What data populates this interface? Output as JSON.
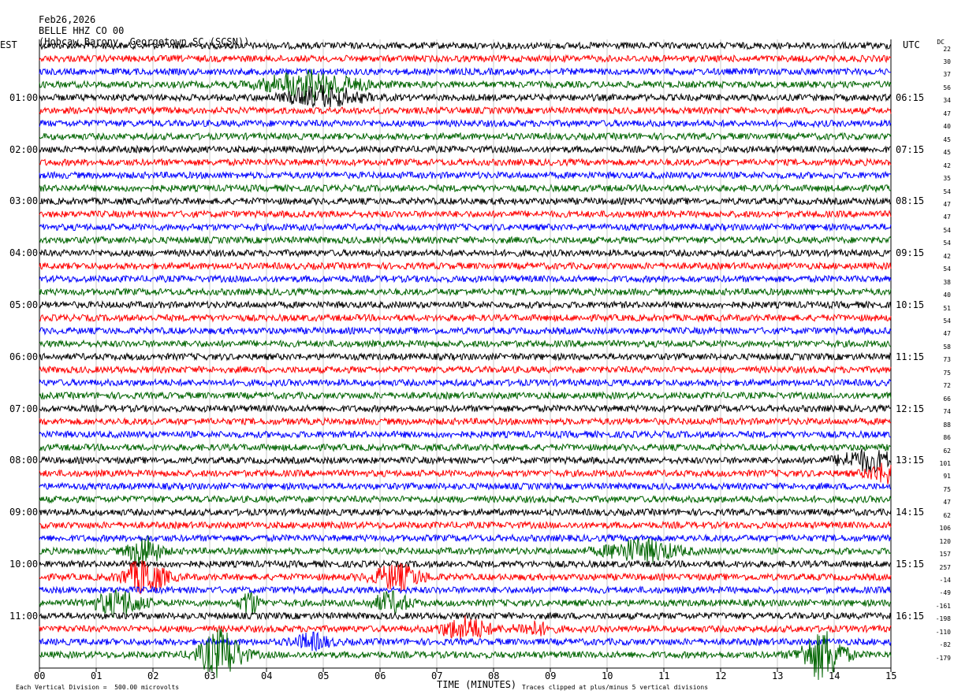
{
  "header": {
    "date": "Feb26,2026",
    "station": "BELLE HHZ CO 00",
    "location": "(Hobcaw Barony, Georgetown SC (SCSN))"
  },
  "left_axis_title": "EST",
  "right_axis_title": "UTC",
  "dc_label": "DC",
  "footer": {
    "scale": "Each Vertical Division =  500.00 microvolts",
    "xlabel": "TIME (MINUTES)",
    "clip_note": "Traces clipped at plus/minus 5 vertical divisions"
  },
  "colors": {
    "trace_cycle": [
      "#000000",
      "#ff0000",
      "#0000ff",
      "#006400"
    ],
    "grid": "#c8c8c8"
  },
  "chart_data": {
    "type": "line",
    "title": "BELLE HHZ CO 00",
    "xlabel": "TIME (MINUTES)",
    "xlim": [
      0,
      15
    ],
    "x_ticks": [
      "00",
      "01",
      "02",
      "03",
      "04",
      "05",
      "06",
      "07",
      "08",
      "09",
      "10",
      "11",
      "12",
      "13",
      "14",
      "15"
    ],
    "rows": 48,
    "minutes_per_row": 15,
    "left_time_labels": [
      "01:00",
      "02:00",
      "03:00",
      "04:00",
      "05:00",
      "06:00",
      "07:00",
      "08:00",
      "09:00",
      "10:00",
      "11:00"
    ],
    "right_time_labels": [
      "06:15",
      "07:15",
      "08:15",
      "09:15",
      "10:15",
      "11:15",
      "12:15",
      "13:15",
      "14:15",
      "15:15",
      "16:15"
    ],
    "dc_offsets": [
      22,
      30,
      37,
      56,
      34,
      47,
      40,
      45,
      45,
      42,
      35,
      54,
      47,
      47,
      54,
      54,
      42,
      54,
      38,
      40,
      51,
      54,
      47,
      58,
      73,
      75,
      72,
      66,
      74,
      88,
      86,
      62,
      101,
      91,
      75,
      47,
      62,
      106,
      120,
      157,
      257,
      -14,
      -49,
      -161,
      -198,
      -110,
      -82,
      -179
    ],
    "events": [
      {
        "row": 3,
        "minute": 4.8,
        "amp": 2.2,
        "width": 0.8
      },
      {
        "row": 4,
        "minute": 5.0,
        "amp": 1.6,
        "width": 0.6
      },
      {
        "row": 32,
        "minute": 14.6,
        "amp": 2.0,
        "width": 0.5
      },
      {
        "row": 33,
        "minute": 14.9,
        "amp": 1.8,
        "width": 0.3
      },
      {
        "row": 39,
        "minute": 10.6,
        "amp": 2.2,
        "width": 0.6
      },
      {
        "row": 39,
        "minute": 1.85,
        "amp": 3.2,
        "width": 0.25
      },
      {
        "row": 41,
        "minute": 1.85,
        "amp": 3.5,
        "width": 0.35
      },
      {
        "row": 41,
        "minute": 6.3,
        "amp": 2.5,
        "width": 0.4
      },
      {
        "row": 43,
        "minute": 1.4,
        "amp": 2.5,
        "width": 0.4
      },
      {
        "row": 43,
        "minute": 6.2,
        "amp": 2.0,
        "width": 0.3
      },
      {
        "row": 43,
        "minute": 3.7,
        "amp": 2.5,
        "width": 0.15
      },
      {
        "row": 45,
        "minute": 7.5,
        "amp": 2.2,
        "width": 0.4
      },
      {
        "row": 45,
        "minute": 8.7,
        "amp": 1.2,
        "width": 0.3
      },
      {
        "row": 46,
        "minute": 4.8,
        "amp": 1.5,
        "width": 0.3
      },
      {
        "row": 47,
        "minute": 3.2,
        "amp": 5.0,
        "width": 0.35
      },
      {
        "row": 47,
        "minute": 13.8,
        "amp": 5.0,
        "width": 0.35
      }
    ]
  }
}
